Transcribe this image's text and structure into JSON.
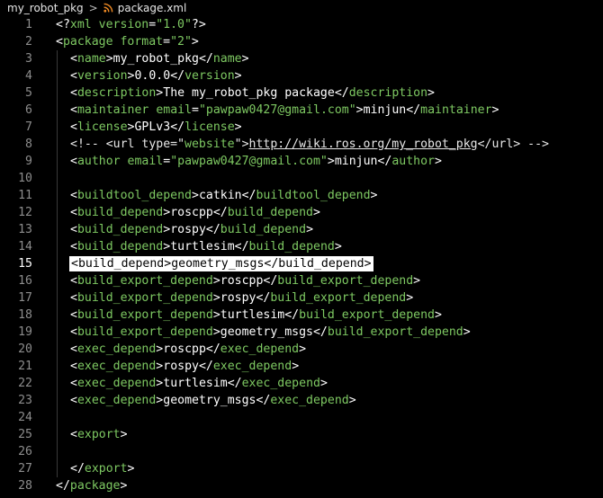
{
  "breadcrumb": {
    "folder": "my_robot_pkg",
    "separator": ">",
    "file_icon": "rss-icon",
    "file": "package.xml"
  },
  "editor": {
    "active_line": 15,
    "lines": [
      {
        "n": "1",
        "parts": [
          [
            "p",
            "<?"
          ],
          [
            "t",
            "xml"
          ],
          [
            "x",
            " "
          ],
          [
            "a",
            "version"
          ],
          [
            "x",
            "="
          ],
          [
            "s",
            "\"1.0\""
          ],
          [
            "p",
            "?>"
          ]
        ]
      },
      {
        "n": "2",
        "parts": [
          [
            "p",
            "<"
          ],
          [
            "t",
            "package"
          ],
          [
            "x",
            " "
          ],
          [
            "a",
            "format"
          ],
          [
            "x",
            "="
          ],
          [
            "s",
            "\"2\""
          ],
          [
            "p",
            ">"
          ]
        ]
      },
      {
        "n": "3",
        "indent": 1,
        "parts": [
          [
            "p",
            "<"
          ],
          [
            "t",
            "name"
          ],
          [
            "p",
            ">"
          ],
          [
            "x",
            "my_robot_pkg"
          ],
          [
            "p",
            "</"
          ],
          [
            "t",
            "name"
          ],
          [
            "p",
            ">"
          ]
        ]
      },
      {
        "n": "4",
        "indent": 1,
        "parts": [
          [
            "p",
            "<"
          ],
          [
            "t",
            "version"
          ],
          [
            "p",
            ">"
          ],
          [
            "x",
            "0.0.0"
          ],
          [
            "p",
            "</"
          ],
          [
            "t",
            "version"
          ],
          [
            "p",
            ">"
          ]
        ]
      },
      {
        "n": "5",
        "indent": 1,
        "parts": [
          [
            "p",
            "<"
          ],
          [
            "t",
            "description"
          ],
          [
            "p",
            ">"
          ],
          [
            "x",
            "The my_robot_pkg package"
          ],
          [
            "p",
            "</"
          ],
          [
            "t",
            "description"
          ],
          [
            "p",
            ">"
          ]
        ]
      },
      {
        "n": "6",
        "indent": 1,
        "parts": [
          [
            "p",
            "<"
          ],
          [
            "t",
            "maintainer"
          ],
          [
            "x",
            " "
          ],
          [
            "a",
            "email"
          ],
          [
            "x",
            "="
          ],
          [
            "s",
            "\"pawpaw0427@gmail.com\""
          ],
          [
            "p",
            ">"
          ],
          [
            "x",
            "minjun"
          ],
          [
            "p",
            "</"
          ],
          [
            "t",
            "maintainer"
          ],
          [
            "p",
            ">"
          ]
        ]
      },
      {
        "n": "7",
        "indent": 1,
        "parts": [
          [
            "p",
            "<"
          ],
          [
            "t",
            "license"
          ],
          [
            "p",
            ">"
          ],
          [
            "x",
            "GPLv3"
          ],
          [
            "p",
            "</"
          ],
          [
            "t",
            "license"
          ],
          [
            "p",
            ">"
          ]
        ]
      },
      {
        "n": "8",
        "indent": 1,
        "parts": [
          [
            "c",
            "<!-- <url type=\""
          ],
          [
            "s",
            "website"
          ],
          [
            "c",
            "\">"
          ],
          [
            "cu",
            "http://wiki.ros.org/my_robot_pkg"
          ],
          [
            "c",
            "</url> -->"
          ]
        ]
      },
      {
        "n": "9",
        "indent": 1,
        "parts": [
          [
            "p",
            "<"
          ],
          [
            "t",
            "author"
          ],
          [
            "x",
            " "
          ],
          [
            "a",
            "email"
          ],
          [
            "x",
            "="
          ],
          [
            "s",
            "\"pawpaw0427@gmail.com\""
          ],
          [
            "p",
            ">"
          ],
          [
            "x",
            "minjun"
          ],
          [
            "p",
            "</"
          ],
          [
            "t",
            "author"
          ],
          [
            "p",
            ">"
          ]
        ]
      },
      {
        "n": "10",
        "parts": []
      },
      {
        "n": "11",
        "indent": 1,
        "parts": [
          [
            "p",
            "<"
          ],
          [
            "t",
            "buildtool_depend"
          ],
          [
            "p",
            ">"
          ],
          [
            "x",
            "catkin"
          ],
          [
            "p",
            "</"
          ],
          [
            "t",
            "buildtool_depend"
          ],
          [
            "p",
            ">"
          ]
        ]
      },
      {
        "n": "12",
        "indent": 1,
        "parts": [
          [
            "p",
            "<"
          ],
          [
            "t",
            "build_depend"
          ],
          [
            "p",
            ">"
          ],
          [
            "x",
            "roscpp"
          ],
          [
            "p",
            "</"
          ],
          [
            "t",
            "build_depend"
          ],
          [
            "p",
            ">"
          ]
        ]
      },
      {
        "n": "13",
        "indent": 1,
        "parts": [
          [
            "p",
            "<"
          ],
          [
            "t",
            "build_depend"
          ],
          [
            "p",
            ">"
          ],
          [
            "x",
            "rospy"
          ],
          [
            "p",
            "</"
          ],
          [
            "t",
            "build_depend"
          ],
          [
            "p",
            ">"
          ]
        ]
      },
      {
        "n": "14",
        "indent": 1,
        "parts": [
          [
            "p",
            "<"
          ],
          [
            "t",
            "build_depend"
          ],
          [
            "p",
            ">"
          ],
          [
            "x",
            "turtlesim"
          ],
          [
            "p",
            "</"
          ],
          [
            "t",
            "build_depend"
          ],
          [
            "p",
            ">"
          ]
        ]
      },
      {
        "n": "15",
        "indent": 1,
        "highlight": true,
        "parts": [
          [
            "p",
            "<"
          ],
          [
            "t",
            "build_depend"
          ],
          [
            "p",
            ">"
          ],
          [
            "x",
            "geometry_msgs"
          ],
          [
            "p",
            "</"
          ],
          [
            "t",
            "build_depend"
          ],
          [
            "p",
            ">"
          ]
        ]
      },
      {
        "n": "16",
        "indent": 1,
        "parts": [
          [
            "p",
            "<"
          ],
          [
            "t",
            "build_export_depend"
          ],
          [
            "p",
            ">"
          ],
          [
            "x",
            "roscpp"
          ],
          [
            "p",
            "</"
          ],
          [
            "t",
            "build_export_depend"
          ],
          [
            "p",
            ">"
          ]
        ]
      },
      {
        "n": "17",
        "indent": 1,
        "parts": [
          [
            "p",
            "<"
          ],
          [
            "t",
            "build_export_depend"
          ],
          [
            "p",
            ">"
          ],
          [
            "x",
            "rospy"
          ],
          [
            "p",
            "</"
          ],
          [
            "t",
            "build_export_depend"
          ],
          [
            "p",
            ">"
          ]
        ]
      },
      {
        "n": "18",
        "indent": 1,
        "parts": [
          [
            "p",
            "<"
          ],
          [
            "t",
            "build_export_depend"
          ],
          [
            "p",
            ">"
          ],
          [
            "x",
            "turtlesim"
          ],
          [
            "p",
            "</"
          ],
          [
            "t",
            "build_export_depend"
          ],
          [
            "p",
            ">"
          ]
        ]
      },
      {
        "n": "19",
        "indent": 1,
        "parts": [
          [
            "p",
            "<"
          ],
          [
            "t",
            "build_export_depend"
          ],
          [
            "p",
            ">"
          ],
          [
            "x",
            "geometry_msgs"
          ],
          [
            "p",
            "</"
          ],
          [
            "t",
            "build_export_depend"
          ],
          [
            "p",
            ">"
          ]
        ]
      },
      {
        "n": "20",
        "indent": 1,
        "parts": [
          [
            "p",
            "<"
          ],
          [
            "t",
            "exec_depend"
          ],
          [
            "p",
            ">"
          ],
          [
            "x",
            "roscpp"
          ],
          [
            "p",
            "</"
          ],
          [
            "t",
            "exec_depend"
          ],
          [
            "p",
            ">"
          ]
        ]
      },
      {
        "n": "21",
        "indent": 1,
        "parts": [
          [
            "p",
            "<"
          ],
          [
            "t",
            "exec_depend"
          ],
          [
            "p",
            ">"
          ],
          [
            "x",
            "rospy"
          ],
          [
            "p",
            "</"
          ],
          [
            "t",
            "exec_depend"
          ],
          [
            "p",
            ">"
          ]
        ]
      },
      {
        "n": "22",
        "indent": 1,
        "parts": [
          [
            "p",
            "<"
          ],
          [
            "t",
            "exec_depend"
          ],
          [
            "p",
            ">"
          ],
          [
            "x",
            "turtlesim"
          ],
          [
            "p",
            "</"
          ],
          [
            "t",
            "exec_depend"
          ],
          [
            "p",
            ">"
          ]
        ]
      },
      {
        "n": "23",
        "indent": 1,
        "parts": [
          [
            "p",
            "<"
          ],
          [
            "t",
            "exec_depend"
          ],
          [
            "p",
            ">"
          ],
          [
            "x",
            "geometry_msgs"
          ],
          [
            "p",
            "</"
          ],
          [
            "t",
            "exec_depend"
          ],
          [
            "p",
            ">"
          ]
        ]
      },
      {
        "n": "24",
        "parts": []
      },
      {
        "n": "25",
        "indent": 1,
        "parts": [
          [
            "p",
            "<"
          ],
          [
            "t",
            "export"
          ],
          [
            "p",
            ">"
          ]
        ]
      },
      {
        "n": "26",
        "parts": []
      },
      {
        "n": "27",
        "indent": 1,
        "parts": [
          [
            "p",
            "</"
          ],
          [
            "t",
            "export"
          ],
          [
            "p",
            ">"
          ]
        ]
      },
      {
        "n": "28",
        "parts": [
          [
            "p",
            "</"
          ],
          [
            "t",
            "package"
          ],
          [
            "p",
            ">"
          ]
        ]
      }
    ]
  },
  "colors": {
    "background": "#000000",
    "tag": "#7ec962",
    "text": "#ffffff",
    "line_number": "#8d8d8d",
    "highlight_bg": "#ffffff",
    "rss_icon": "#f08a24"
  }
}
